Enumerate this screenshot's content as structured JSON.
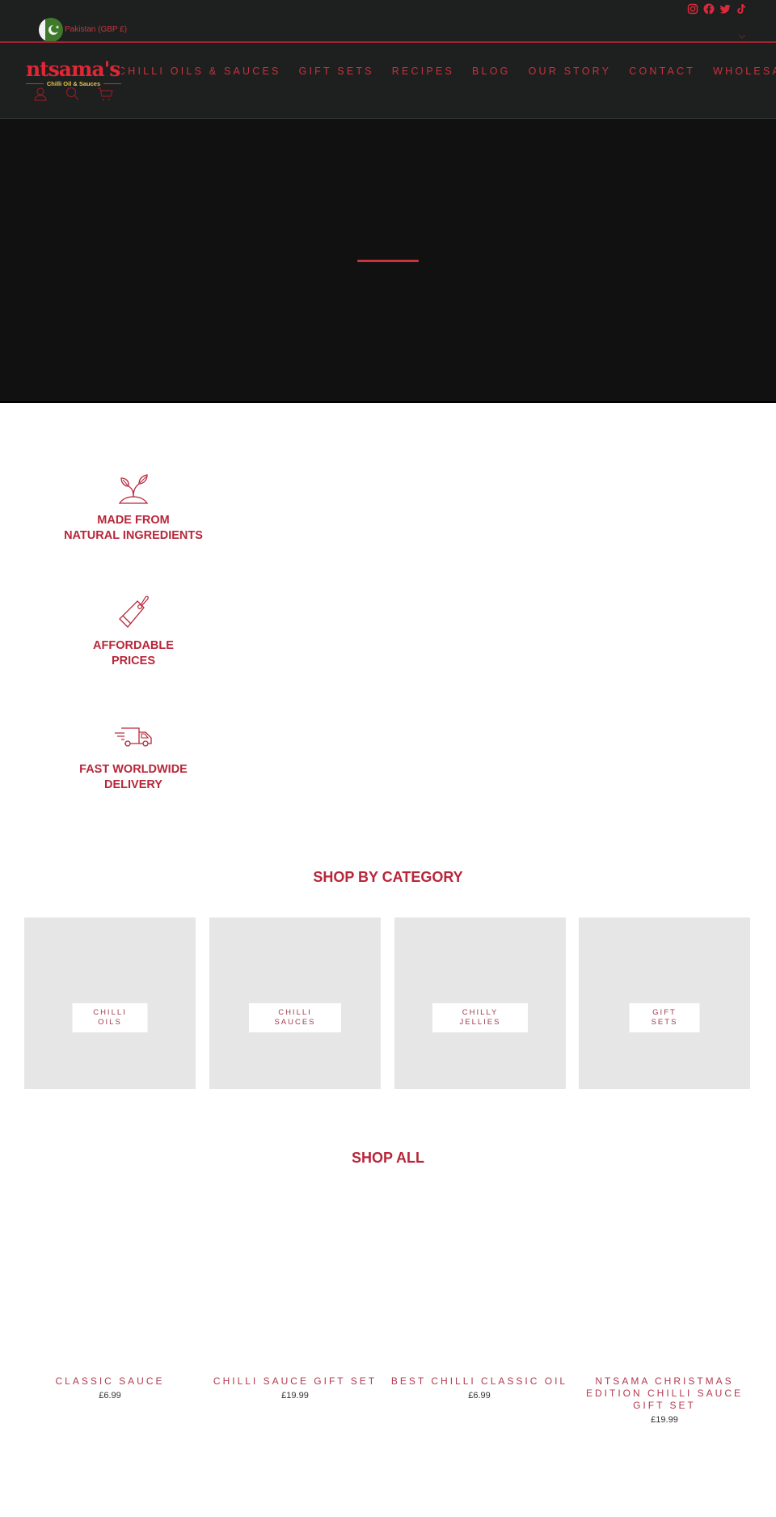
{
  "topbar": {
    "country": "Pakistan (GBP £)",
    "socials": [
      "instagram-icon",
      "facebook-icon",
      "twitter-icon",
      "tiktok-icon"
    ]
  },
  "header": {
    "logo": {
      "word": "ntsama's",
      "tagline": "Chilli Oil & Sauces"
    },
    "nav": [
      {
        "label": "CHILLI OILS & SAUCES"
      },
      {
        "label": "GIFT SETS"
      },
      {
        "label": "RECIPES"
      },
      {
        "label": "BLOG"
      },
      {
        "label": "OUR STORY"
      },
      {
        "label": "CONTACT"
      },
      {
        "label": "WHOLESALE"
      }
    ],
    "icons": [
      "account-icon",
      "search-icon",
      "cart-icon"
    ]
  },
  "features": [
    {
      "icon": "plant-icon",
      "line1": "MADE FROM",
      "line2": "NATURAL INGREDIENTS"
    },
    {
      "icon": "price-tag-icon",
      "line1": "AFFORDABLE",
      "line2": "PRICES"
    },
    {
      "icon": "delivery-truck-icon",
      "line1": "FAST WORLDWIDE",
      "line2": "DELIVERY"
    }
  ],
  "shop_by_category": {
    "title": "SHOP BY CATEGORY",
    "items": [
      {
        "line1": "CHILLI",
        "line2": "OILS"
      },
      {
        "line1": "CHILLI",
        "line2": "SAUCES"
      },
      {
        "line1": "CHILLY",
        "line2": "JELLIES"
      },
      {
        "line1": "GIFT",
        "line2": "SETS"
      }
    ]
  },
  "shop_all": {
    "title": "SHOP ALL",
    "products": [
      {
        "name": "CLASSIC SAUCE",
        "price": "£6.99"
      },
      {
        "name": "CHILLI SAUCE GIFT SET",
        "price": "£19.99"
      },
      {
        "name": "BEST CHILLI CLASSIC OIL",
        "price": "£6.99"
      },
      {
        "name": "NTSAMA CHRISTMAS EDITION CHILLI SAUCE GIFT SET",
        "price": "£19.99"
      }
    ]
  },
  "colors": {
    "brand_red": "#c9333d",
    "heading_red": "#b8263a",
    "header_bg": "#1e1f1f",
    "hero_bg": "#111111",
    "category_bg": "#e6e6e6"
  }
}
